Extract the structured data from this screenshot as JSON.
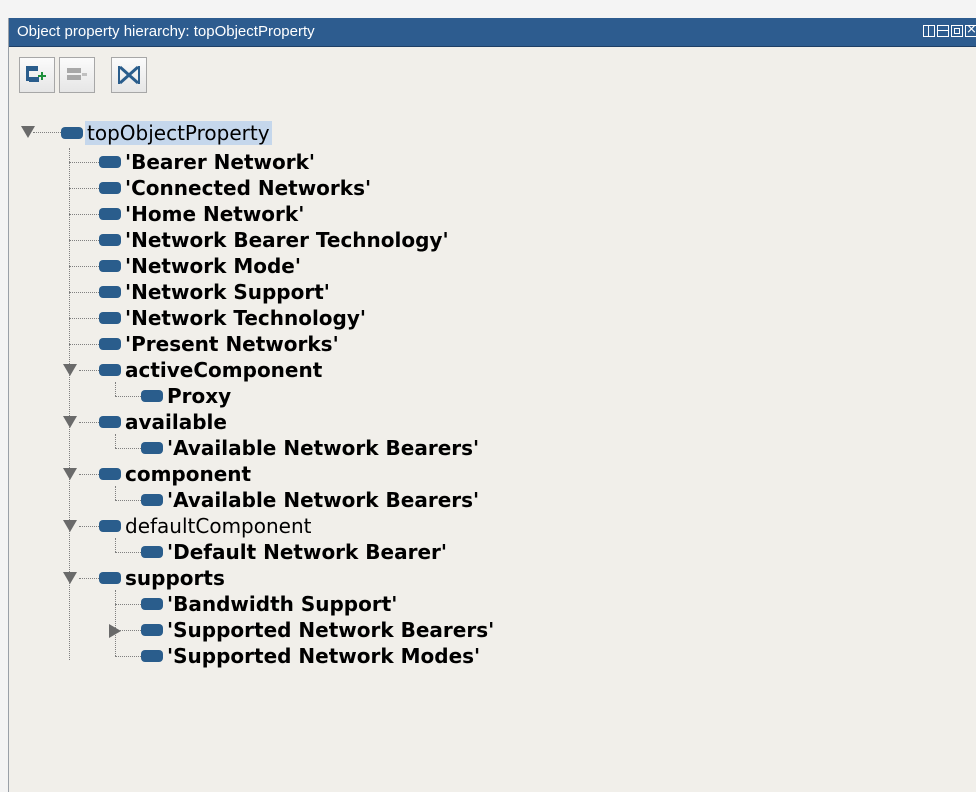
{
  "window": {
    "title": "Object property hierarchy: topObjectProperty",
    "controls": [
      "split-view-icon",
      "horizontal-split-icon",
      "maximize-icon",
      "close-icon"
    ]
  },
  "toolbar": {
    "add_sub_icon": "add-subproperty-icon",
    "add_sibling_icon": "add-sibling-icon",
    "delete_icon": "delete-property-icon"
  },
  "tree": {
    "root": "topObjectProperty",
    "items": [
      "'Bearer Network'",
      "'Connected Networks'",
      "'Home Network'",
      "'Network Bearer Technology'",
      "'Network Mode'",
      "'Network Support'",
      "'Network Technology'",
      "'Present Networks'",
      "activeComponent",
      "Proxy",
      "available",
      "'Available Network Bearers'",
      "component",
      "'Available Network Bearers'",
      "defaultComponent",
      "'Default Network Bearer'",
      "supports",
      "'Bandwidth Support'",
      "'Supported Network Bearers'",
      "'Supported Network Modes'"
    ]
  },
  "colors": {
    "titlebar": "#2d5c8f",
    "bullet": "#2a5d8c",
    "selection": "#c5d7ec"
  }
}
